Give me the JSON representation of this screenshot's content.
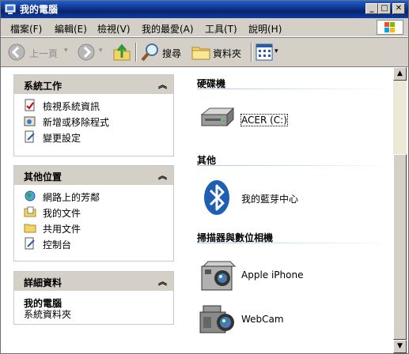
{
  "window": {
    "title": "我的電腦",
    "buttons": {
      "minimize": "_",
      "maximize": "□",
      "close": "✕"
    }
  },
  "menubar": {
    "items": [
      {
        "label": "檔案(F)"
      },
      {
        "label": "編輯(E)"
      },
      {
        "label": "檢視(V)"
      },
      {
        "label": "我的最愛(A)"
      },
      {
        "label": "工具(T)"
      },
      {
        "label": "說明(H)"
      }
    ]
  },
  "toolbar": {
    "back_label": "上一頁",
    "search_label": "搜尋",
    "folders_label": "資料夾"
  },
  "taskpane": {
    "system_tasks": {
      "title": "系統工作",
      "items": [
        {
          "label": "檢視系統資訊"
        },
        {
          "label": "新增或移除程式"
        },
        {
          "label": "變更設定"
        }
      ]
    },
    "other_places": {
      "title": "其他位置",
      "items": [
        {
          "label": "網路上的芳鄰"
        },
        {
          "label": "我的文件"
        },
        {
          "label": "共用文件"
        },
        {
          "label": "控制台"
        }
      ]
    },
    "details": {
      "title": "詳細資料",
      "name": "我的電腦",
      "type": "系統資料夾"
    }
  },
  "content": {
    "groups": [
      {
        "title": "硬碟機",
        "items": [
          {
            "label": "ACER (C:)"
          }
        ]
      },
      {
        "title": "其他",
        "items": [
          {
            "label": "我的藍芽中心"
          }
        ]
      },
      {
        "title": "掃描器與數位相機",
        "items": [
          {
            "label": "Apple iPhone"
          },
          {
            "label": "WebCam"
          }
        ]
      }
    ]
  },
  "colors": {
    "titlebar": "#0a246a",
    "chrome": "#d4d0c8",
    "bluetooth": "#1e5fb4"
  }
}
